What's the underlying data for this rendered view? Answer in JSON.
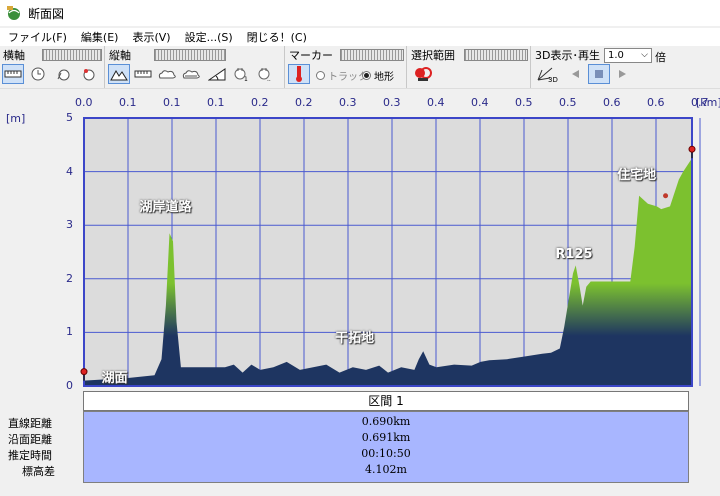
{
  "window": {
    "title": "断面図",
    "icon": "app-globe-icon"
  },
  "menu": [
    {
      "label": "ファイル(F)"
    },
    {
      "label": "編集(E)"
    },
    {
      "label": "表示(V)"
    },
    {
      "label": "設定...(S)"
    },
    {
      "label": "閉じる！(C)"
    }
  ],
  "toolbar": {
    "horizontal_axis": {
      "label": "横軸"
    },
    "vertical_axis": {
      "label": "縦軸"
    },
    "marker": {
      "label": "マーカー",
      "option_track": "トラック",
      "option_terrain": "地形",
      "selected": "地形"
    },
    "selection": {
      "label": "選択範囲"
    },
    "playback": {
      "label": "3D表示･再生",
      "speed_value": "1.0",
      "speed_unit": "倍"
    }
  },
  "chart_data": {
    "type": "area",
    "x_unit": "[km]",
    "y_unit": "[m]",
    "x_tick_labels": [
      "0.0",
      "0.1",
      "0.1",
      "0.1",
      "0.2",
      "0.2",
      "0.3",
      "0.3",
      "0.4",
      "0.4",
      "0.5",
      "0.5",
      "0.6",
      "0.6",
      "0.7"
    ],
    "y_ticks": [
      0,
      1,
      2,
      3,
      4,
      5
    ],
    "ylim": [
      0,
      5
    ],
    "xlim": [
      0,
      0.69
    ],
    "grid": true,
    "fill_colors": {
      "low": "#1e3561",
      "high": "#7cc12f"
    },
    "profile": [
      [
        0.0,
        0.1
      ],
      [
        0.05,
        0.15
      ],
      [
        0.08,
        0.2
      ],
      [
        0.088,
        0.5
      ],
      [
        0.093,
        1.5
      ],
      [
        0.097,
        2.85
      ],
      [
        0.101,
        2.7
      ],
      [
        0.105,
        1.2
      ],
      [
        0.11,
        0.35
      ],
      [
        0.13,
        0.35
      ],
      [
        0.16,
        0.35
      ],
      [
        0.17,
        0.4
      ],
      [
        0.18,
        0.25
      ],
      [
        0.19,
        0.4
      ],
      [
        0.2,
        0.3
      ],
      [
        0.215,
        0.35
      ],
      [
        0.23,
        0.45
      ],
      [
        0.245,
        0.3
      ],
      [
        0.26,
        0.35
      ],
      [
        0.275,
        0.4
      ],
      [
        0.29,
        0.25
      ],
      [
        0.305,
        0.35
      ],
      [
        0.32,
        0.3
      ],
      [
        0.335,
        0.38
      ],
      [
        0.345,
        0.25
      ],
      [
        0.36,
        0.35
      ],
      [
        0.375,
        0.3
      ],
      [
        0.38,
        0.5
      ],
      [
        0.385,
        0.65
      ],
      [
        0.392,
        0.4
      ],
      [
        0.4,
        0.35
      ],
      [
        0.42,
        0.4
      ],
      [
        0.44,
        0.38
      ],
      [
        0.45,
        0.45
      ],
      [
        0.46,
        0.48
      ],
      [
        0.48,
        0.5
      ],
      [
        0.5,
        0.55
      ],
      [
        0.52,
        0.6
      ],
      [
        0.53,
        0.62
      ],
      [
        0.54,
        0.7
      ],
      [
        0.545,
        1.1
      ],
      [
        0.55,
        1.6
      ],
      [
        0.555,
        2.1
      ],
      [
        0.558,
        2.25
      ],
      [
        0.562,
        1.9
      ],
      [
        0.566,
        1.5
      ],
      [
        0.57,
        1.85
      ],
      [
        0.575,
        1.95
      ],
      [
        0.59,
        1.95
      ],
      [
        0.62,
        1.95
      ],
      [
        0.625,
        2.6
      ],
      [
        0.63,
        3.55
      ],
      [
        0.64,
        3.4
      ],
      [
        0.65,
        3.35
      ],
      [
        0.655,
        3.3
      ],
      [
        0.665,
        3.35
      ],
      [
        0.675,
        3.85
      ],
      [
        0.68,
        4.0
      ],
      [
        0.69,
        4.25
      ]
    ],
    "start_marker": [
      0.0,
      0.1
    ],
    "end_marker": [
      0.69,
      4.25
    ],
    "annotations": [
      {
        "text": "湖面",
        "x": 0.02,
        "y": 0.35
      },
      {
        "text": "湖岸道路",
        "x": 0.063,
        "y": 3.55
      },
      {
        "text": "干拓地",
        "x": 0.285,
        "y": 1.1
      },
      {
        "text": "R125",
        "x": 0.535,
        "y": 2.6
      },
      {
        "text": "住宅地",
        "x": 0.605,
        "y": 4.15
      }
    ]
  },
  "section": {
    "header": "区間 1"
  },
  "stats": [
    {
      "label": "直線距離",
      "value": "0.690km"
    },
    {
      "label": "沿面距離",
      "value": "0.691km"
    },
    {
      "label": "推定時間",
      "value": "00:10:50"
    },
    {
      "label": "標高差",
      "value": "4.102m"
    }
  ]
}
